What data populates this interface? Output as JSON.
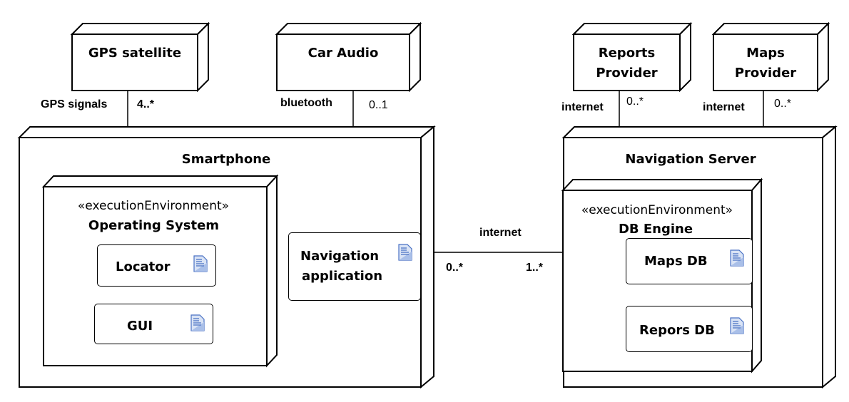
{
  "nodes": {
    "gps_satellite": {
      "title": "GPS satellite"
    },
    "car_audio": {
      "title": "Car Audio"
    },
    "reports_provider": {
      "title_line1": "Reports",
      "title_line2": "Provider"
    },
    "maps_provider": {
      "title_line1": "Maps",
      "title_line2": "Provider"
    },
    "smartphone": {
      "title": "Smartphone",
      "execution_environment": {
        "stereotype": "«executionEnvironment»",
        "name": "Operating System",
        "artifacts": [
          "Locator",
          "GUI"
        ]
      },
      "artifact": {
        "line1": "Navigation",
        "line2": "application"
      }
    },
    "navigation_server": {
      "title": "Navigation Server",
      "execution_environment": {
        "stereotype": "«executionEnvironment»",
        "name": "DB Engine",
        "artifacts": [
          "Maps DB",
          "Repors DB"
        ]
      }
    }
  },
  "associations": {
    "gps": {
      "label": "GPS signals",
      "multiplicity": "4..*"
    },
    "car_audio": {
      "label": "bluetooth",
      "multiplicity": "0..1"
    },
    "reports": {
      "label": "internet",
      "multiplicity": "0..*"
    },
    "maps": {
      "label": "internet",
      "multiplicity": "0..*"
    },
    "phone_server": {
      "label": "internet",
      "mult_phone": "0..*",
      "mult_server": "1..*"
    }
  },
  "icons": {
    "artifact": "artifact-document-icon"
  },
  "colors": {
    "line": "#000000",
    "icon_blue": "#4a72c4",
    "icon_fill": "#d9e3f5"
  }
}
